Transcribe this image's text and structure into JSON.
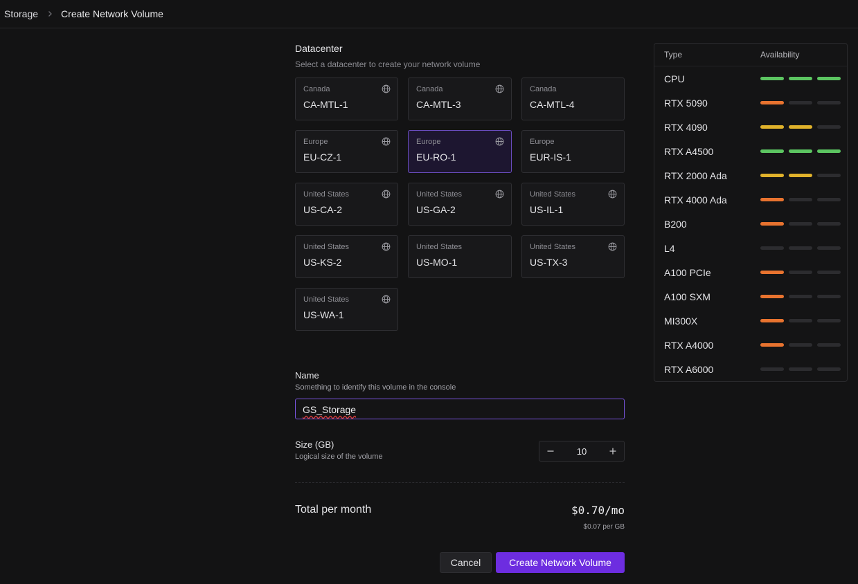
{
  "breadcrumb": {
    "parent": "Storage",
    "current": "Create Network Volume"
  },
  "datacenter": {
    "title": "Datacenter",
    "subtitle": "Select a datacenter to create your network volume",
    "selected": "EU-RO-1",
    "items": [
      {
        "region": "Canada",
        "code": "CA-MTL-1",
        "globe": true
      },
      {
        "region": "Canada",
        "code": "CA-MTL-3",
        "globe": true
      },
      {
        "region": "Canada",
        "code": "CA-MTL-4",
        "globe": false
      },
      {
        "region": "Europe",
        "code": "EU-CZ-1",
        "globe": true
      },
      {
        "region": "Europe",
        "code": "EU-RO-1",
        "globe": true
      },
      {
        "region": "Europe",
        "code": "EUR-IS-1",
        "globe": false
      },
      {
        "region": "United States",
        "code": "US-CA-2",
        "globe": true
      },
      {
        "region": "United States",
        "code": "US-GA-2",
        "globe": true
      },
      {
        "region": "United States",
        "code": "US-IL-1",
        "globe": true
      },
      {
        "region": "United States",
        "code": "US-KS-2",
        "globe": true
      },
      {
        "region": "United States",
        "code": "US-MO-1",
        "globe": false
      },
      {
        "region": "United States",
        "code": "US-TX-3",
        "globe": true
      },
      {
        "region": "United States",
        "code": "US-WA-1",
        "globe": true
      }
    ]
  },
  "name_field": {
    "label": "Name",
    "hint": "Something to identify this volume in the console",
    "value": "GS_Storage"
  },
  "size_field": {
    "label": "Size (GB)",
    "hint": "Logical size of the volume",
    "value": "10"
  },
  "total": {
    "label": "Total per month",
    "value": "$0.70/mo",
    "per_gb": "$0.07 per GB"
  },
  "actions": {
    "cancel": "Cancel",
    "create": "Create Network Volume"
  },
  "availability": {
    "col_type": "Type",
    "col_availability": "Availability",
    "colors": {
      "high": "#5cc561",
      "medium": "#e0b22b",
      "low": "#e8732f",
      "none": "#2c2c2f"
    },
    "rows": [
      {
        "type": "CPU",
        "level": 3,
        "tone": "high"
      },
      {
        "type": "RTX 5090",
        "level": 1,
        "tone": "low"
      },
      {
        "type": "RTX 4090",
        "level": 2,
        "tone": "medium"
      },
      {
        "type": "RTX A4500",
        "level": 3,
        "tone": "high"
      },
      {
        "type": "RTX 2000 Ada",
        "level": 2,
        "tone": "medium"
      },
      {
        "type": "RTX 4000 Ada",
        "level": 1,
        "tone": "low"
      },
      {
        "type": "B200",
        "level": 1,
        "tone": "low"
      },
      {
        "type": "L4",
        "level": 0,
        "tone": "none"
      },
      {
        "type": "A100 PCIe",
        "level": 1,
        "tone": "low"
      },
      {
        "type": "A100 SXM",
        "level": 1,
        "tone": "low"
      },
      {
        "type": "MI300X",
        "level": 1,
        "tone": "low"
      },
      {
        "type": "RTX A4000",
        "level": 1,
        "tone": "low"
      },
      {
        "type": "RTX A6000",
        "level": 0,
        "tone": "none"
      }
    ]
  }
}
